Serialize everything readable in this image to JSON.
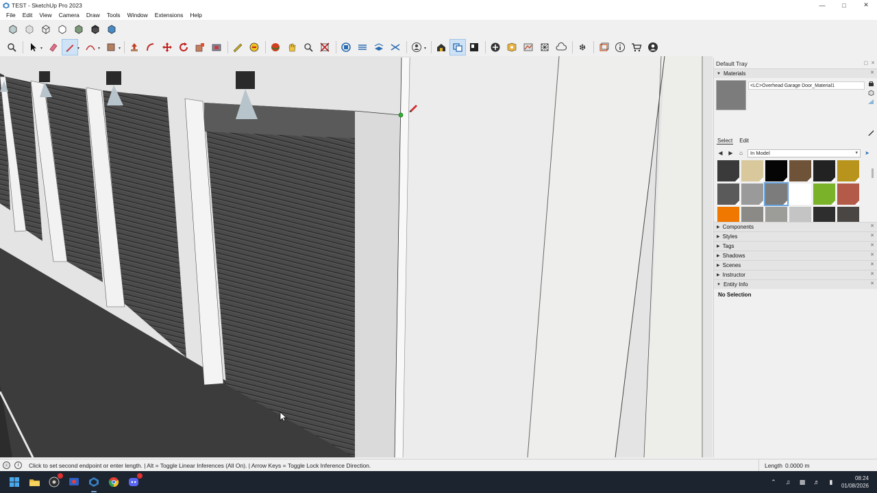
{
  "window": {
    "title": "TEST - SketchUp Pro 2023",
    "controls": [
      "minimize",
      "maximize",
      "close"
    ]
  },
  "menu": [
    "File",
    "Edit",
    "View",
    "Camera",
    "Draw",
    "Tools",
    "Window",
    "Extensions",
    "Help"
  ],
  "toolbar_styles": [
    "xray-icon",
    "back-edges-icon",
    "wireframe-icon",
    "hidden-line-icon",
    "shaded-icon",
    "shaded-textures-icon",
    "monochrome-icon"
  ],
  "toolbar_main": [
    "zoom-icon",
    "select-icon",
    "eraser-icon",
    "line-pencil-icon",
    "arc-icon",
    "rectangle-icon",
    "push-pull-icon",
    "offset-icon",
    "move-icon",
    "rotate-icon",
    "scale-icon",
    "follow-me-icon",
    "tape-measure-icon",
    "paint-bucket-icon",
    "orbit-icon",
    "pan-icon",
    "zoom-window-icon",
    "zoom-extents-icon",
    "section-plane-icon",
    "display-section-planes-icon",
    "section-fill-icon",
    "display-section-cuts-icon",
    "user-icon",
    "warehouse-icon",
    "extension-warehouse-icon",
    "layout-icon",
    "add-location-icon",
    "geo-icon",
    "photo-texture-icon",
    "trimble-connect-icon",
    "extension-manager-icon",
    "scenes-icon",
    "info-icon",
    "cart-icon",
    "account-icon"
  ],
  "tray": {
    "title": "Default Tray",
    "materials": {
      "header": "Materials",
      "current_name": "<LC>Overhead Garage Door_Material1",
      "tabs": [
        "Select",
        "Edit"
      ],
      "library": "In Model",
      "swatches": [
        "#3a3a3a",
        "#d8c89c",
        "#050505",
        "#6e5338",
        "#222222",
        "#b8941c",
        "#5a5a5a",
        "#9a9a9a",
        "#7c7c7c",
        "#ffffff",
        "#7ab32a",
        "#b35a48",
        "#f07800",
        "#8c8a86",
        "#9c9c98",
        "#c4c4c4",
        "#2e2e2e",
        "#4a4644",
        "#202020",
        "#5e5e5e",
        "#a8a8a8",
        "#eeeeee",
        "#f4f4f4",
        "#d67254"
      ]
    },
    "panels": [
      "Components",
      "Styles",
      "Tags",
      "Shadows",
      "Scenes",
      "Instructor",
      "Entity Info"
    ],
    "entity_info": "No Selection"
  },
  "status": {
    "message": "Click to set second endpoint or enter length. | Alt = Toggle Linear Inferences (All On). | Arrow Keys = Toggle Lock Inference Direction.",
    "vcb_label": "Length",
    "vcb_value": "0.0000 m"
  },
  "taskbar": {
    "apps": [
      "windows-start-icon",
      "file-explorer-icon",
      "chrome-app-icon",
      "screen-recorder-icon",
      "sketchup-app-icon",
      "chrome-icon",
      "discord-icon"
    ],
    "time": "08:24",
    "date": "01/08/2026"
  }
}
